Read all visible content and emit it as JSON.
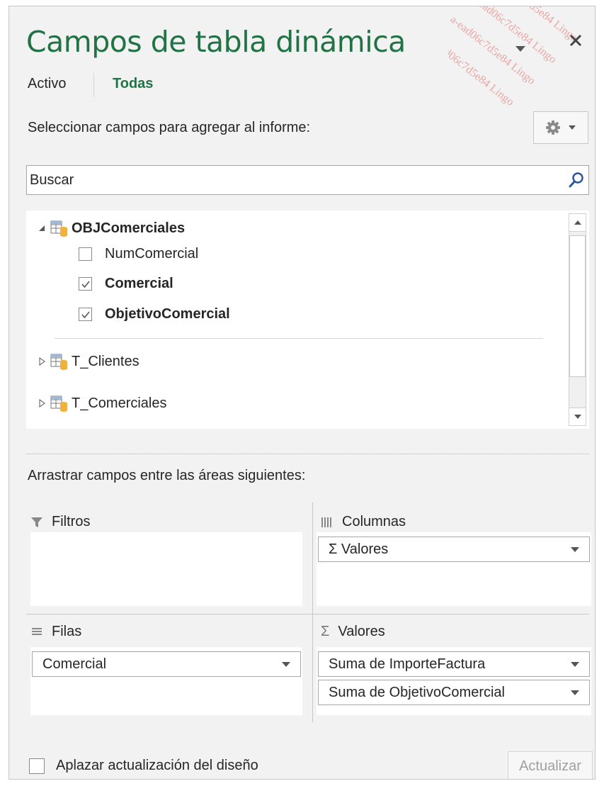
{
  "pane": {
    "title": "Campos de tabla dinámica",
    "tabs": [
      {
        "label": "Activo",
        "active": false
      },
      {
        "label": "Todas",
        "active": true
      }
    ],
    "watermark": "a-ead06c7d5e84 Lingo"
  },
  "field_section": {
    "heading": "Seleccionar campos para agregar al informe:",
    "search_placeholder": "Buscar",
    "tables": [
      {
        "name": "OBJComerciales",
        "expanded": true,
        "fields": [
          {
            "name": "NumComercial",
            "checked": false
          },
          {
            "name": "Comercial",
            "checked": true
          },
          {
            "name": "ObjetivoComercial",
            "checked": true
          }
        ]
      },
      {
        "name": "T_Clientes",
        "expanded": false
      },
      {
        "name": "T_Comerciales",
        "expanded": false
      }
    ]
  },
  "areas": {
    "heading": "Arrastrar campos entre las áreas siguientes:",
    "filters": {
      "label": "Filtros",
      "items": []
    },
    "columns": {
      "label": "Columnas",
      "items": [
        "Σ  Valores"
      ]
    },
    "rows": {
      "label": "Filas",
      "items": [
        "Comercial"
      ]
    },
    "values": {
      "label": "Valores",
      "items": [
        "Suma de ImporteFactura",
        "Suma de ObjetivoComercial"
      ]
    }
  },
  "footer": {
    "defer_label": "Aplazar actualización del diseño",
    "defer_checked": false,
    "update_label": "Actualizar"
  },
  "colors": {
    "accent": "#217346",
    "pane_bg": "#f2f2f2"
  }
}
